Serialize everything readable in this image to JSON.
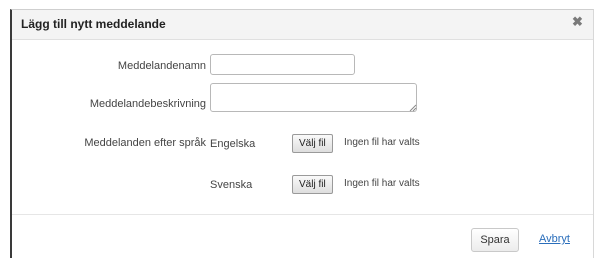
{
  "dialog": {
    "title": "Lägg till nytt meddelande",
    "close_symbol": "✖"
  },
  "form": {
    "name_label": "Meddelandenamn",
    "name_value": "",
    "description_label": "Meddelandebeskrivning",
    "description_value": "",
    "languages_label": "Meddelanden efter språk",
    "languages": [
      {
        "language": "Engelska",
        "button_label": "Välj fil",
        "status": "Ingen fil har valts"
      },
      {
        "language": "Svenska",
        "button_label": "Välj fil",
        "status": "Ingen fil har valts"
      }
    ]
  },
  "footer": {
    "save_label": "Spara",
    "cancel_label": "Avbryt"
  }
}
